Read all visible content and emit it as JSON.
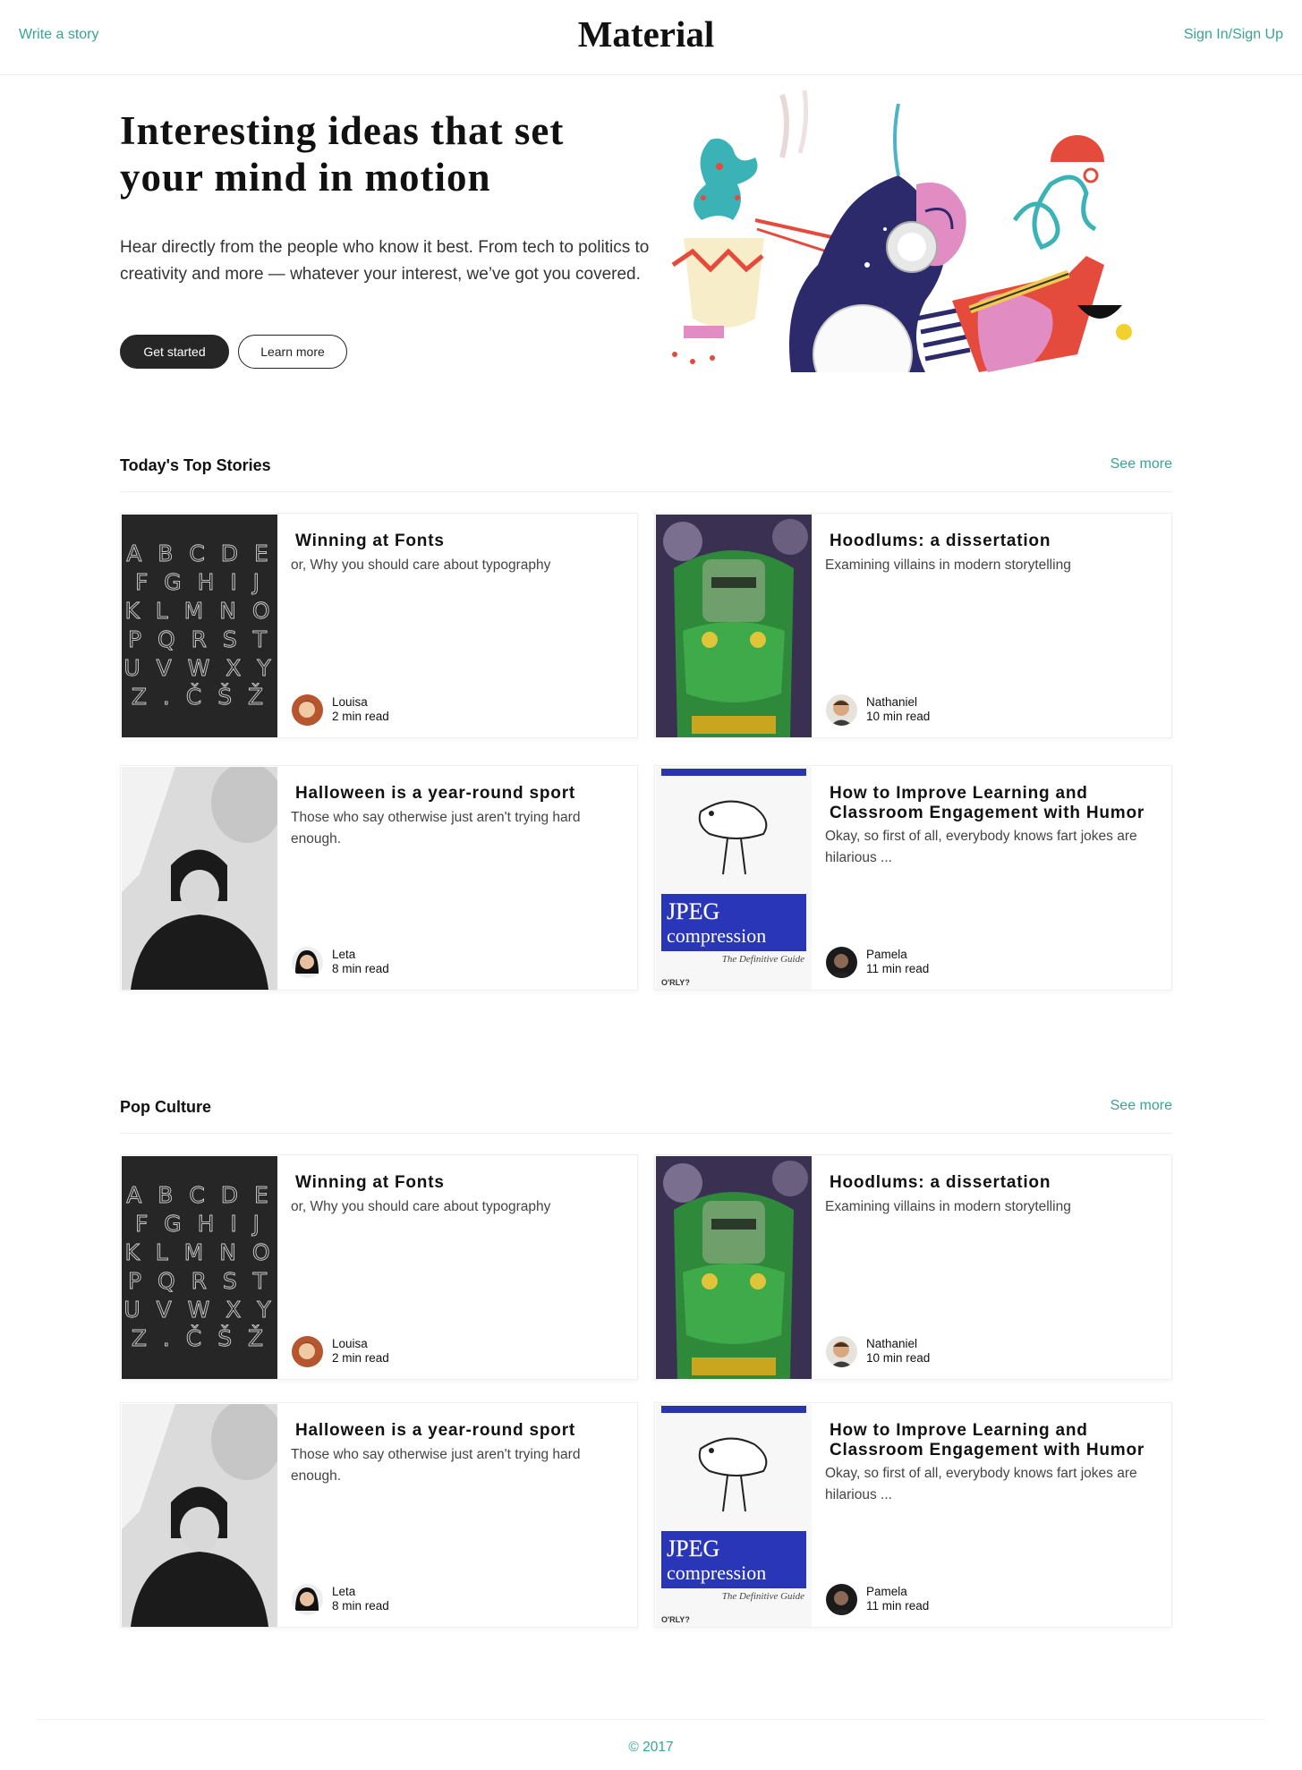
{
  "header": {
    "write_label": "Write a story",
    "brand": "Material",
    "signin_label": "Sign In/Sign Up"
  },
  "hero": {
    "title_line1": "Interesting ideas that set",
    "title_line2": "your mind in motion",
    "description": "Hear directly from the people who know it best. From tech to politics to creativity and more — whatever your interest, we’ve got you covered.",
    "primary_button": "Get started",
    "secondary_button": "Learn more",
    "illustration_icon": "podcast-illustration"
  },
  "sections": [
    {
      "title": "Today's Top Stories",
      "see_more": "See more",
      "stories": [
        {
          "title": "Winning at Fonts",
          "subtitle": "or, Why you should care about typography",
          "author": "Louisa",
          "read_time": "2 min read",
          "thumb_icon": "alphabet-image"
        },
        {
          "title": "Hoodlums: a dissertation",
          "subtitle": "Examining villains in modern storytelling",
          "author": "Nathaniel",
          "read_time": "10 min read",
          "thumb_icon": "villain-comic-image"
        },
        {
          "title": "Halloween is a year-round sport",
          "subtitle": "Those who say otherwise just aren't trying hard enough.",
          "author": "Leta",
          "read_time": "8 min read",
          "thumb_icon": "vintage-portrait-image"
        },
        {
          "title": "How to Improve Learning and Classroom Engagement with Humor",
          "subtitle": "Okay, so first of all, everybody knows fart jokes are hilarious ...",
          "author": "Pamela",
          "read_time": "11 min read",
          "thumb_icon": "jpeg-book-cover-image",
          "cover_text1": "JPEG",
          "cover_text2": "compression",
          "cover_text3": "The Definitive Guide",
          "cover_publisher": "O'RLY?"
        }
      ]
    },
    {
      "title": "Pop Culture",
      "see_more": "See more",
      "stories": [
        {
          "title": "Winning at Fonts",
          "subtitle": "or, Why you should care about typography",
          "author": "Louisa",
          "read_time": "2 min read",
          "thumb_icon": "alphabet-image"
        },
        {
          "title": "Hoodlums: a dissertation",
          "subtitle": "Examining villains in modern storytelling",
          "author": "Nathaniel",
          "read_time": "10 min read",
          "thumb_icon": "villain-comic-image"
        },
        {
          "title": "Halloween is a year-round sport",
          "subtitle": "Those who say otherwise just aren't trying hard enough.",
          "author": "Leta",
          "read_time": "8 min read",
          "thumb_icon": "vintage-portrait-image"
        },
        {
          "title": "How to Improve Learning and Classroom Engagement with Humor",
          "subtitle": "Okay, so first of all, everybody knows fart jokes are hilarious ...",
          "author": "Pamela",
          "read_time": "11 min read",
          "thumb_icon": "jpeg-book-cover-image",
          "cover_text1": "JPEG",
          "cover_text2": "compression",
          "cover_text3": "The Definitive Guide",
          "cover_publisher": "O'RLY?"
        }
      ]
    }
  ],
  "alphabet_rows": [
    "A B C D E",
    "F G H I J",
    "K L M N O",
    "P Q R S T",
    "U V W X Y",
    "Z . Č Š Ž"
  ],
  "footer": {
    "copyright": "© 2017"
  },
  "colors": {
    "accent": "#3aa394",
    "dark_button": "#262626"
  }
}
